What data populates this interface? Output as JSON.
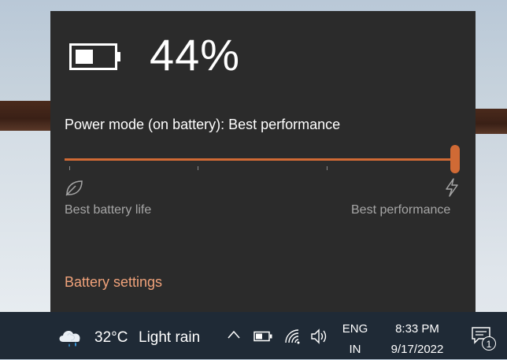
{
  "battery": {
    "percent_text": "44%",
    "level": 0.44
  },
  "power_mode": {
    "title": "Power mode (on battery): Best performance",
    "left_label": "Best battery life",
    "right_label": "Best performance",
    "selected_index": 3,
    "positions": 4
  },
  "battery_settings_link": "Battery settings",
  "taskbar": {
    "weather": {
      "temperature": "32°C",
      "condition": "Light rain",
      "icon": "cloud-rain-icon"
    },
    "language_line1": "ENG",
    "language_line2": "IN",
    "time": "8:33 PM",
    "date": "9/17/2022",
    "notification_count": "1"
  },
  "colors": {
    "accent": "#d06a35",
    "link": "#f0a27a",
    "flyout_bg": "#2b2b2b",
    "taskbar_bg": "#1f2a36"
  }
}
